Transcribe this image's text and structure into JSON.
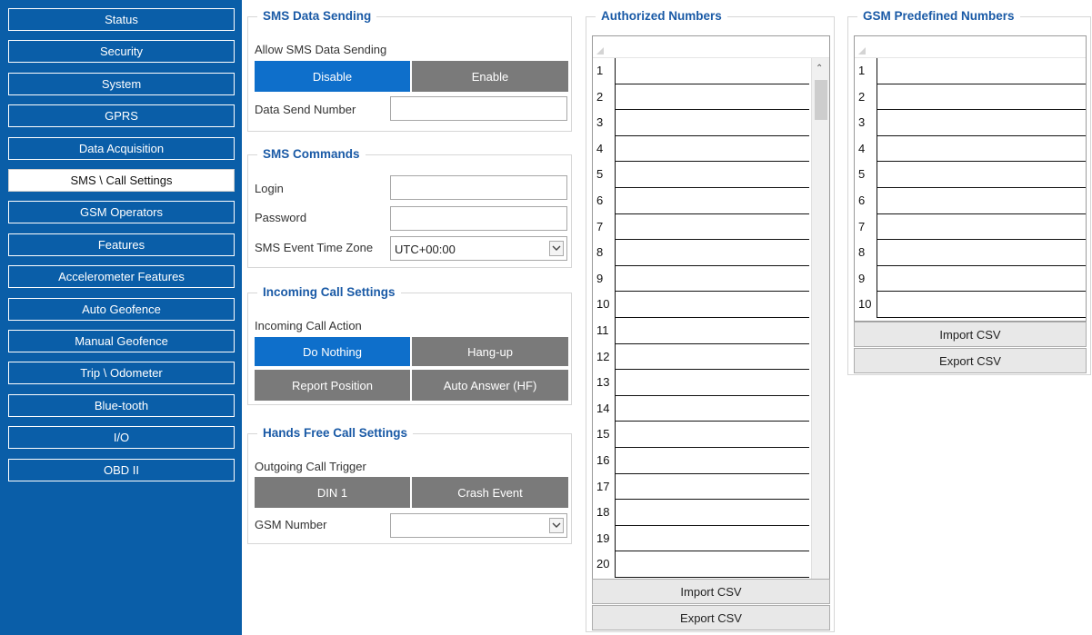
{
  "sidebar": {
    "items": [
      {
        "label": "Status",
        "active": false
      },
      {
        "label": "Security",
        "active": false
      },
      {
        "label": "System",
        "active": false
      },
      {
        "label": "GPRS",
        "active": false
      },
      {
        "label": "Data Acquisition",
        "active": false
      },
      {
        "label": "SMS \\ Call Settings",
        "active": true
      },
      {
        "label": "GSM Operators",
        "active": false
      },
      {
        "label": "Features",
        "active": false
      },
      {
        "label": "Accelerometer Features",
        "active": false
      },
      {
        "label": "Auto Geofence",
        "active": false
      },
      {
        "label": "Manual Geofence",
        "active": false
      },
      {
        "label": "Trip \\ Odometer",
        "active": false
      },
      {
        "label": "Blue-tooth",
        "active": false
      },
      {
        "label": "I/O",
        "active": false
      },
      {
        "label": "OBD II",
        "active": false
      }
    ]
  },
  "sms_data_sending": {
    "title": "SMS Data Sending",
    "allow_label": "Allow SMS Data Sending",
    "disable_label": "Disable",
    "enable_label": "Enable",
    "selected": "Disable",
    "number_label": "Data Send Number",
    "number_value": ""
  },
  "sms_commands": {
    "title": "SMS Commands",
    "login_label": "Login",
    "login_value": "",
    "password_label": "Password",
    "password_value": "",
    "timezone_label": "SMS Event Time Zone",
    "timezone_value": "UTC+00:00"
  },
  "incoming_call": {
    "title": "Incoming Call Settings",
    "action_label": "Incoming Call Action",
    "options": [
      "Do Nothing",
      "Hang-up",
      "Report Position",
      "Auto Answer (HF)"
    ],
    "selected": "Do Nothing"
  },
  "hands_free": {
    "title": "Hands Free Call Settings",
    "trigger_label": "Outgoing Call Trigger",
    "din_label": "DIN 1",
    "crash_label": "Crash Event",
    "gsm_number_label": "GSM Number",
    "gsm_number_value": ""
  },
  "authorized_numbers": {
    "title": "Authorized Numbers",
    "rows": [
      "1",
      "2",
      "3",
      "4",
      "5",
      "6",
      "7",
      "8",
      "9",
      "10",
      "11",
      "12",
      "13",
      "14",
      "15",
      "16",
      "17",
      "18",
      "19",
      "20"
    ],
    "import_label": "Import CSV",
    "export_label": "Export CSV"
  },
  "gsm_predefined": {
    "title": "GSM Predefined Numbers",
    "rows": [
      "1",
      "2",
      "3",
      "4",
      "5",
      "6",
      "7",
      "8",
      "9",
      "10"
    ],
    "import_label": "Import CSV",
    "export_label": "Export CSV"
  },
  "colors": {
    "sidebar_bg": "#0a5ea8",
    "accent_blue": "#0e6fcb",
    "toggle_gray": "#7a7a7a",
    "title_blue": "#1a5aa6"
  }
}
